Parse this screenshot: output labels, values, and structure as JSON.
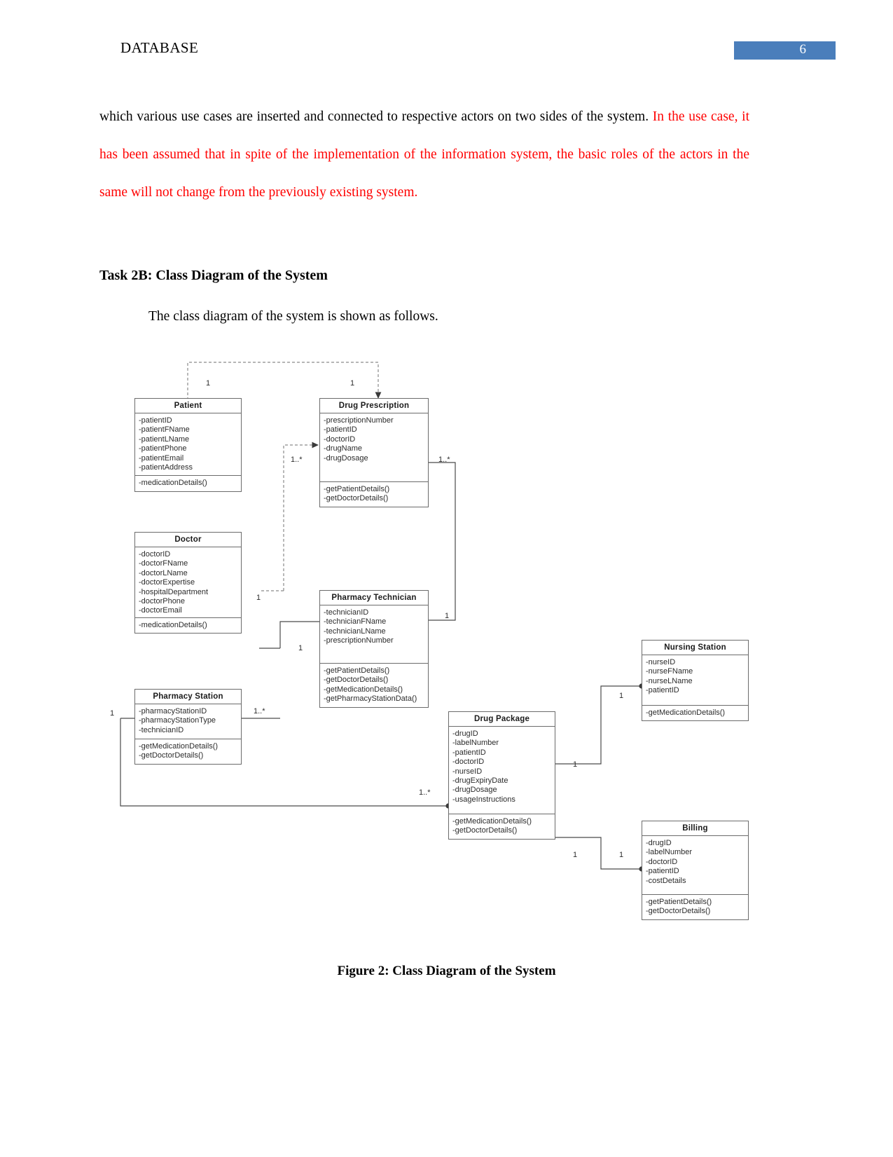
{
  "header": {
    "title": "DATABASE",
    "page_number": "6",
    "badge_color": "#4a7ebb"
  },
  "body": {
    "paragraph_black": "which various use cases are inserted and connected to respective actors on two sides of the system. ",
    "paragraph_red": "In the use case, it has been assumed that in spite of the implementation of the information system, the basic roles of the actors in the same will not change from the previously existing system.",
    "task_heading": "Task 2B: Class Diagram of the System",
    "intro_line": "The class diagram of the system is shown as follows.",
    "figure_caption": "Figure 2: Class Diagram of the System",
    "red_color": "#ff0000"
  },
  "diagram": {
    "classes": [
      {
        "id": "patient",
        "name": "Patient",
        "attributes": [
          "-patientID",
          "-patientFName",
          "-patientLName",
          "-patientPhone",
          "-patientEmail",
          "-patientAddress"
        ],
        "operations": [
          "-medicationDetails()"
        ]
      },
      {
        "id": "drug_prescription",
        "name": "Drug Prescription",
        "attributes": [
          "-prescriptionNumber",
          "-patientID",
          "-doctorID",
          "-drugName",
          "-drugDosage"
        ],
        "operations": [
          "-getPatientDetails()",
          "-getDoctorDetails()"
        ]
      },
      {
        "id": "doctor",
        "name": "Doctor",
        "attributes": [
          "-doctorID",
          "-doctorFName",
          "-doctorLName",
          "-doctorExpertise",
          "-hospitalDepartment",
          "-doctorPhone",
          "-doctorEmail"
        ],
        "operations": [
          "-medicationDetails()"
        ]
      },
      {
        "id": "pharmacy_technician",
        "name": "Pharmacy Technician",
        "attributes": [
          "-technicianID",
          "-technicianFName",
          "-technicianLName",
          "-prescriptionNumber"
        ],
        "operations": [
          "-getPatientDetails()",
          "-getDoctorDetails()",
          "-getMedicationDetails()",
          "-getPharmacyStationData()"
        ]
      },
      {
        "id": "pharmacy_station",
        "name": "Pharmacy Station",
        "attributes": [
          "-pharmacyStationID",
          "-pharmacyStationType",
          "-technicianID"
        ],
        "operations": [
          "-getMedicationDetails()",
          "-getDoctorDetails()"
        ]
      },
      {
        "id": "nursing_station",
        "name": "Nursing Station",
        "attributes": [
          "-nurseID",
          "-nurseFName",
          "-nurseLName",
          "-patientID"
        ],
        "operations": [
          "-getMedicationDetails()"
        ]
      },
      {
        "id": "drug_package",
        "name": "Drug Package",
        "attributes": [
          "-drugID",
          "-labelNumber",
          "-patientID",
          "-doctorID",
          "-nurseID",
          "-drugExpiryDate",
          "-drugDosage",
          "-usageInstructions"
        ],
        "operations": [
          "-getMedicationDetails()",
          "-getDoctorDetails()"
        ]
      },
      {
        "id": "billing",
        "name": "Billing",
        "attributes": [
          "-drugID",
          "-labelNumber",
          "-doctorID",
          "-patientID",
          "-costDetails"
        ],
        "operations": [
          "-getPatientDetails()",
          "-getDoctorDetails()"
        ]
      }
    ],
    "multiplicities": [
      {
        "id": "m1",
        "label": "1"
      },
      {
        "id": "m2",
        "label": "1"
      },
      {
        "id": "m3",
        "label": "1..*"
      },
      {
        "id": "m4",
        "label": "1..*"
      },
      {
        "id": "m5",
        "label": "1"
      },
      {
        "id": "m6",
        "label": "1"
      },
      {
        "id": "m7",
        "label": "1"
      },
      {
        "id": "m8",
        "label": "1"
      },
      {
        "id": "m9",
        "label": "1..*"
      },
      {
        "id": "m10",
        "label": "1"
      },
      {
        "id": "m11",
        "label": "1"
      },
      {
        "id": "m12",
        "label": "1..*"
      },
      {
        "id": "m13",
        "label": "1"
      },
      {
        "id": "m14",
        "label": "1"
      }
    ]
  }
}
